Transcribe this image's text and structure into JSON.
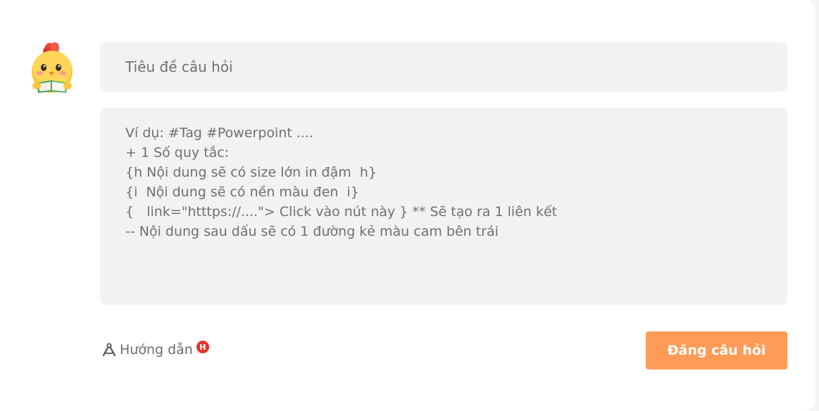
{
  "title_field": {
    "placeholder": "Tiêu đề câu hỏi",
    "value": ""
  },
  "content_field": {
    "placeholder": "Ví dụ: #Tag #Powerpoint ....\n+ 1 Số quy tắc:\n{h Nội dung sẽ có size lớn in đậm  h}\n{i  Nội dung sẽ có nền màu đen  i}\n{   link=\"htttps://....\"> Click vào nút này } ** Sẽ tạo ra 1 liên kết\n-- Nội dung sau dấu sẽ có 1 đường kẻ màu cam bên trái",
    "value": ""
  },
  "guide": {
    "label": "Hướng dẫn",
    "badge": "H",
    "icon": "compass-icon"
  },
  "submit": {
    "label": "Đăng câu hỏi"
  },
  "avatar": {
    "icon": "chick-mascot-avatar"
  },
  "colors": {
    "accent": "#ff9b57",
    "field_background": "#f2f2f2",
    "badge": "#e5322d"
  }
}
